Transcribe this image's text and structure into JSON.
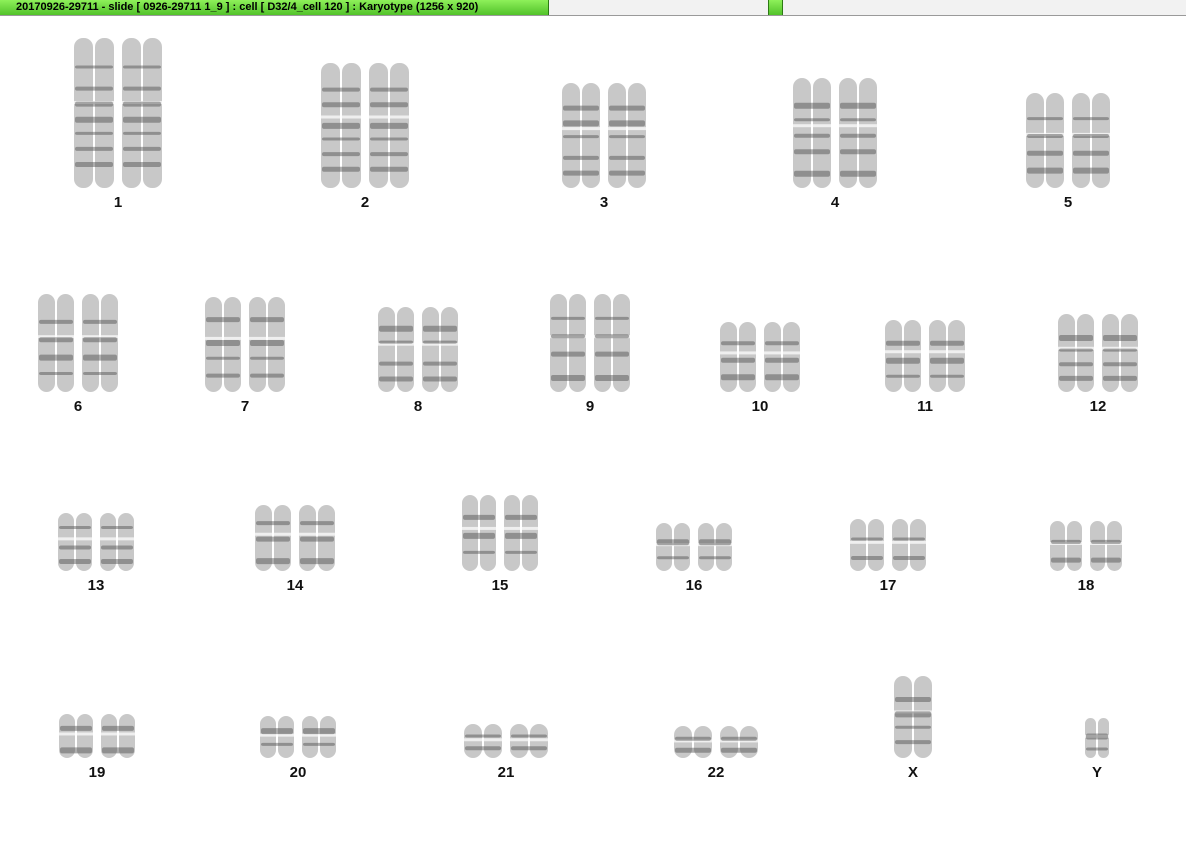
{
  "window": {
    "title": "20170926-29711 - slide [ 0926-29711 1_9 ] : cell [ D32/4_cell 120 ] : Karyotype  (1256 x 920)"
  },
  "karyotype": {
    "groups": [
      {
        "label": "1"
      },
      {
        "label": "2"
      },
      {
        "label": "3"
      },
      {
        "label": "4"
      },
      {
        "label": "5"
      },
      {
        "label": "6"
      },
      {
        "label": "7"
      },
      {
        "label": "8"
      },
      {
        "label": "9"
      },
      {
        "label": "10"
      },
      {
        "label": "11"
      },
      {
        "label": "12"
      },
      {
        "label": "13"
      },
      {
        "label": "14"
      },
      {
        "label": "15"
      },
      {
        "label": "16"
      },
      {
        "label": "17"
      },
      {
        "label": "18"
      },
      {
        "label": "19"
      },
      {
        "label": "20"
      },
      {
        "label": "21"
      },
      {
        "label": "22"
      },
      {
        "label": "X"
      },
      {
        "label": "Y"
      }
    ]
  },
  "colors": {
    "title_green": "#66d23c",
    "chromatid": "#9a9a9a",
    "band": "#4a4a4a"
  }
}
